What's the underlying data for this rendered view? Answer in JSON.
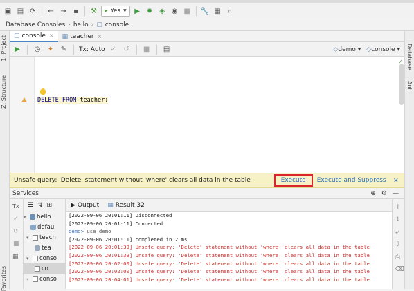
{
  "toolbar": {
    "yes_label": "Yes"
  },
  "breadcrumb": {
    "items": [
      "Database Consoles",
      "hello",
      "console"
    ]
  },
  "left_strip": {
    "project": "1: Project",
    "structure": "Z: Structure",
    "favorites": "Favorites"
  },
  "right_strip": {
    "database": "Database",
    "ant": "Ant"
  },
  "editor_tabs": [
    {
      "label": "console"
    },
    {
      "label": "teacher"
    }
  ],
  "console_toolbar": {
    "tx_label": "Tx: Auto",
    "datasource": "demo",
    "session": "console"
  },
  "editor": {
    "code_keyword1": "DELETE",
    "code_keyword2": "FROM",
    "code_rest": " teacher;"
  },
  "notice": {
    "message": "Unsafe query: 'Delete' statement without 'where' clears all data in the table",
    "execute_label": "Execute",
    "execute_suppress_label": "Execute and Suppress"
  },
  "services": {
    "title": "Services",
    "tree": [
      {
        "label": "hello",
        "depth": 0
      },
      {
        "label": "defau",
        "depth": 1
      },
      {
        "label": "teach",
        "depth": 1
      },
      {
        "label": "tea",
        "depth": 2
      },
      {
        "label": "conso",
        "depth": 1
      },
      {
        "label": "co",
        "depth": 2
      },
      {
        "label": "conso",
        "depth": 1
      }
    ],
    "output_tab": "Output",
    "result_tab": "Result 32"
  },
  "output_lines": [
    {
      "text": "[2022-09-06 20:01:11] Disconnected",
      "kind": "normal"
    },
    {
      "text": "[2022-09-06 20:01:11] Connected",
      "kind": "normal"
    },
    {
      "prompt": "demo>",
      "text": " use demo",
      "kind": "cmd"
    },
    {
      "text": "[2022-09-06 20:01:11] completed in 2 ms",
      "kind": "normal"
    },
    {
      "text": "[2022-09-06 20:01:39] Unsafe query: 'Delete' statement without 'where' clears all data in the table",
      "kind": "err"
    },
    {
      "text": "[2022-09-06 20:01:39] Unsafe query: 'Delete' statement without 'where' clears all data in the table",
      "kind": "err"
    },
    {
      "text": "[2022-09-06 20:02:00] Unsafe query: 'Delete' statement without 'where' clears all data in the table",
      "kind": "err"
    },
    {
      "text": "[2022-09-06 20:02:00] Unsafe query: 'Delete' statement without 'where' clears all data in the table",
      "kind": "err"
    },
    {
      "text": "[2022-09-06 20:04:01] Unsafe query: 'Delete' statement without 'where' clears all data in the table",
      "kind": "err"
    }
  ],
  "colors": {
    "accent": "#4a88c7",
    "warning_bg": "#f6f2c6",
    "error_text": "#c9302c",
    "link": "#2c6bbd",
    "highlight_border": "#d9252b"
  }
}
